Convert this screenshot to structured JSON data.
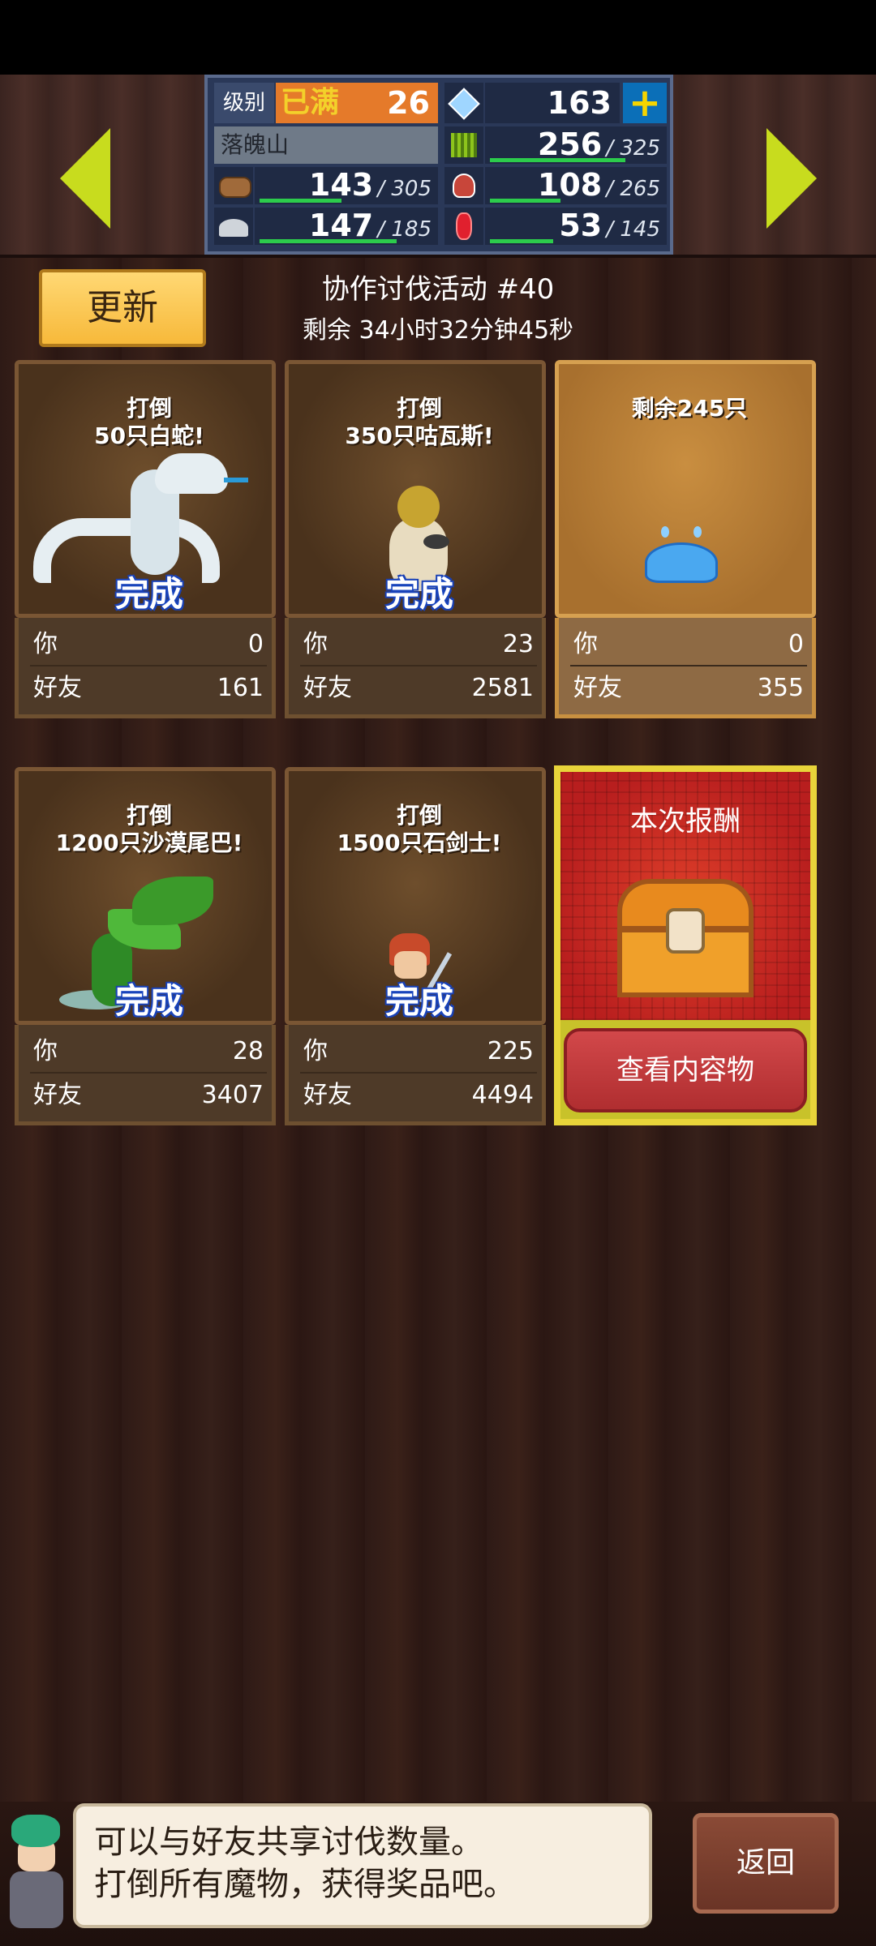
{
  "header": {
    "level_label": "级别",
    "level_status": "已满",
    "level_value": "26",
    "gems": "163",
    "location": "落魄山",
    "resources": [
      {
        "icon": "grass-icon",
        "current": "256",
        "max": "/ 325",
        "fill": 0.79
      },
      {
        "icon": "wood-icon",
        "current": "143",
        "max": "/ 305",
        "fill": 0.47
      },
      {
        "icon": "food-icon",
        "current": "108",
        "max": "/ 265",
        "fill": 0.41
      },
      {
        "icon": "ore-icon",
        "current": "147",
        "max": "/ 185",
        "fill": 0.79
      },
      {
        "icon": "ruby-icon",
        "current": "53",
        "max": "/ 145",
        "fill": 0.37
      }
    ]
  },
  "event": {
    "refresh_label": "更新",
    "title": "协作讨伐活动 #40",
    "timer": "剩余 34小时32分钟45秒"
  },
  "cards": [
    {
      "heading": "打倒\n50只白蛇!",
      "status": "完成",
      "you_label": "你",
      "you": "0",
      "friends_label": "好友",
      "friends": "161"
    },
    {
      "heading": "打倒\n350只咕瓦斯!",
      "status": "完成",
      "you_label": "你",
      "you": "23",
      "friends_label": "好友",
      "friends": "2581"
    },
    {
      "heading": "剩余245只",
      "status": "",
      "you_label": "你",
      "you": "0",
      "friends_label": "好友",
      "friends": "355"
    },
    {
      "heading": "打倒\n1200只沙漠尾巴!",
      "status": "完成",
      "you_label": "你",
      "you": "28",
      "friends_label": "好友",
      "friends": "3407"
    },
    {
      "heading": "打倒\n1500只石剑士!",
      "status": "完成",
      "you_label": "你",
      "you": "225",
      "friends_label": "好友",
      "friends": "4494"
    }
  ],
  "reward": {
    "title": "本次报酬",
    "view_label": "查看内容物"
  },
  "dialog": {
    "line1": "可以与好友共享讨伐数量。",
    "line2": "打倒所有魔物，获得奖品吧。"
  },
  "back_label": "返回",
  "colors": {
    "accent_yellow": "#c8dc1e",
    "done_blue": "#1a3fb0",
    "reward_red": "#c8282a"
  }
}
